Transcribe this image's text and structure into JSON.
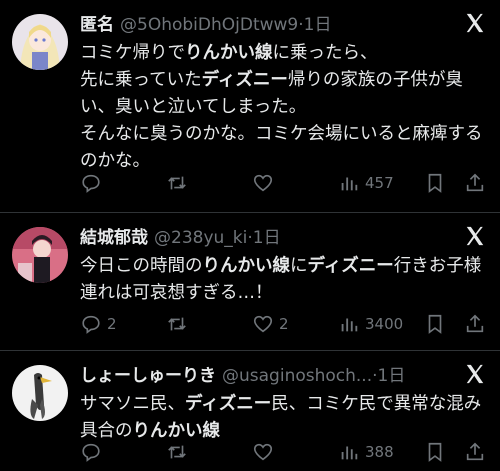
{
  "tweets": [
    {
      "name": "匿名",
      "handle": "@5OhobiDhOjDtww9",
      "dot": "·",
      "time": "1日",
      "text_parts": [
        "コミケ帰りで",
        "りんかい線",
        "に乗ったら、\n先に乗っていた",
        "ディズニー",
        "帰りの家族の子供が臭い、臭いと泣いてしまった。\nそんなに臭うのかな。コミケ会場にいると麻痺するのかな。"
      ],
      "reply_count": "",
      "retweet_count": "",
      "like_count": "",
      "views": "457"
    },
    {
      "name": "結城郁哉",
      "handle": "@238yu_ki",
      "dot": "·",
      "time": "1日",
      "text_parts": [
        "今日この時間の",
        "りんかい線",
        "に",
        "ディズニー",
        "行きお子様連れは可哀想すぎる…！"
      ],
      "reply_count": "2",
      "retweet_count": "",
      "like_count": "2",
      "views": "3400"
    },
    {
      "name": "しょーしゅーりき",
      "handle": "@usaginoshoch...",
      "dot": "·",
      "time": "1日",
      "text_parts": [
        "サマソニ民、",
        "ディズニー",
        "民、コミケ民で異常な混み具合の",
        "りんかい線",
        ""
      ],
      "reply_count": "",
      "retweet_count": "",
      "like_count": "",
      "views": "388"
    }
  ],
  "icons": {
    "reply": "reply-icon",
    "retweet": "retweet-icon",
    "like": "heart-icon",
    "views": "views-chart-icon",
    "bookmark": "bookmark-icon",
    "share": "share-icon",
    "brand": "x-logo-icon"
  },
  "colors": {
    "background": "#000000",
    "text": "#e7e9ea",
    "muted": "#71767b",
    "divider": "#2f3336"
  }
}
